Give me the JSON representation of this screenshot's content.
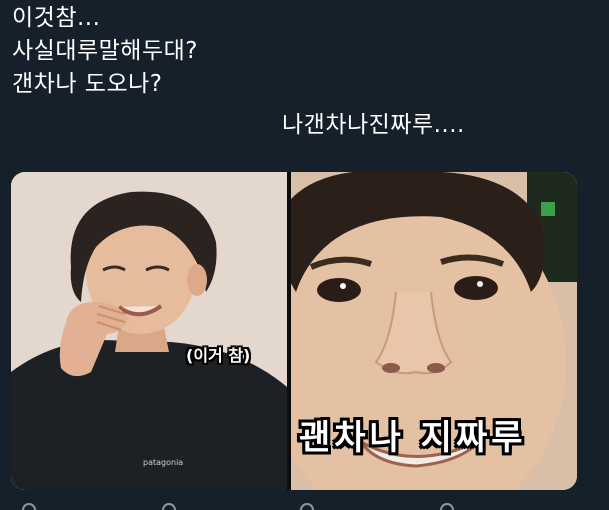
{
  "tweet": {
    "lines": [
      "이것참...",
      "사실대루말해두대?",
      "갠차나 도오나?",
      "나갠차나진짜루...."
    ]
  },
  "media": {
    "left_caption": "(이거 참)",
    "right_caption": "괜차나 지짜루",
    "shirt_logo": "patagonia"
  },
  "colors": {
    "background": "#15202b",
    "text": "#ffffff",
    "icon": "#8899a6"
  },
  "icons": [
    "reply-icon",
    "retweet-icon",
    "like-icon",
    "share-icon"
  ]
}
